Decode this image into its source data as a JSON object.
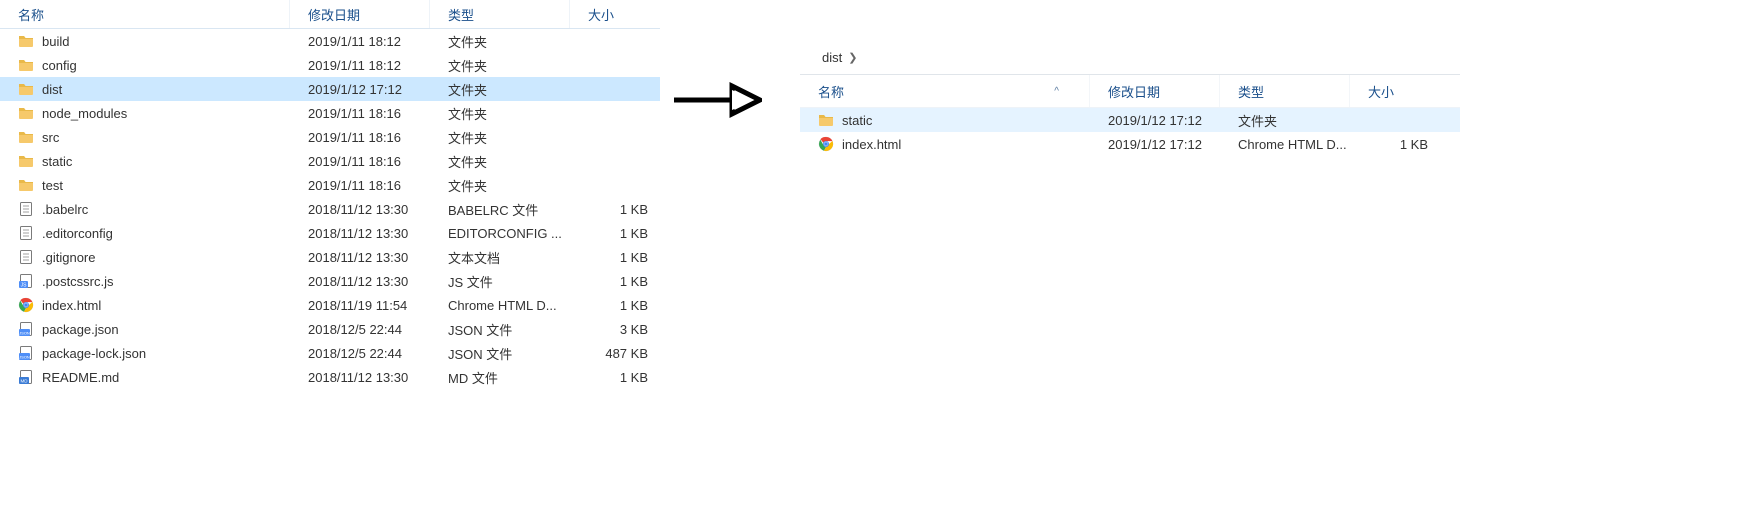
{
  "left": {
    "headers": {
      "name": "名称",
      "date": "修改日期",
      "type": "类型",
      "size": "大小"
    },
    "rows": [
      {
        "icon": "folder",
        "name": "build",
        "date": "2019/1/11 18:12",
        "type": "文件夹",
        "size": "",
        "sel": false
      },
      {
        "icon": "folder",
        "name": "config",
        "date": "2019/1/11 18:12",
        "type": "文件夹",
        "size": "",
        "sel": false
      },
      {
        "icon": "folder",
        "name": "dist",
        "date": "2019/1/12 17:12",
        "type": "文件夹",
        "size": "",
        "sel": true
      },
      {
        "icon": "folder",
        "name": "node_modules",
        "date": "2019/1/11 18:16",
        "type": "文件夹",
        "size": "",
        "sel": false
      },
      {
        "icon": "folder",
        "name": "src",
        "date": "2019/1/11 18:16",
        "type": "文件夹",
        "size": "",
        "sel": false
      },
      {
        "icon": "folder",
        "name": "static",
        "date": "2019/1/11 18:16",
        "type": "文件夹",
        "size": "",
        "sel": false
      },
      {
        "icon": "folder",
        "name": "test",
        "date": "2019/1/11 18:16",
        "type": "文件夹",
        "size": "",
        "sel": false
      },
      {
        "icon": "doc",
        "name": ".babelrc",
        "date": "2018/11/12 13:30",
        "type": "BABELRC 文件",
        "size": "1 KB",
        "sel": false
      },
      {
        "icon": "doc",
        "name": ".editorconfig",
        "date": "2018/11/12 13:30",
        "type": "EDITORCONFIG ...",
        "size": "1 KB",
        "sel": false
      },
      {
        "icon": "doc",
        "name": ".gitignore",
        "date": "2018/11/12 13:30",
        "type": "文本文档",
        "size": "1 KB",
        "sel": false
      },
      {
        "icon": "js",
        "name": ".postcssrc.js",
        "date": "2018/11/12 13:30",
        "type": "JS 文件",
        "size": "1 KB",
        "sel": false
      },
      {
        "icon": "chrome",
        "name": "index.html",
        "date": "2018/11/19 11:54",
        "type": "Chrome HTML D...",
        "size": "1 KB",
        "sel": false
      },
      {
        "icon": "json",
        "name": "package.json",
        "date": "2018/12/5 22:44",
        "type": "JSON 文件",
        "size": "3 KB",
        "sel": false
      },
      {
        "icon": "json",
        "name": "package-lock.json",
        "date": "2018/12/5 22:44",
        "type": "JSON 文件",
        "size": "487 KB",
        "sel": false
      },
      {
        "icon": "md",
        "name": "README.md",
        "date": "2018/11/12 13:30",
        "type": "MD 文件",
        "size": "1 KB",
        "sel": false
      }
    ]
  },
  "right": {
    "breadcrumb": [
      "dist"
    ],
    "headers": {
      "name": "名称",
      "date": "修改日期",
      "type": "类型",
      "size": "大小"
    },
    "sort_caret": "^",
    "rows": [
      {
        "icon": "folder",
        "name": "static",
        "date": "2019/1/12 17:12",
        "type": "文件夹",
        "size": "",
        "hover": true
      },
      {
        "icon": "chrome",
        "name": "index.html",
        "date": "2019/1/12 17:12",
        "type": "Chrome HTML D...",
        "size": "1 KB",
        "hover": false
      }
    ]
  }
}
